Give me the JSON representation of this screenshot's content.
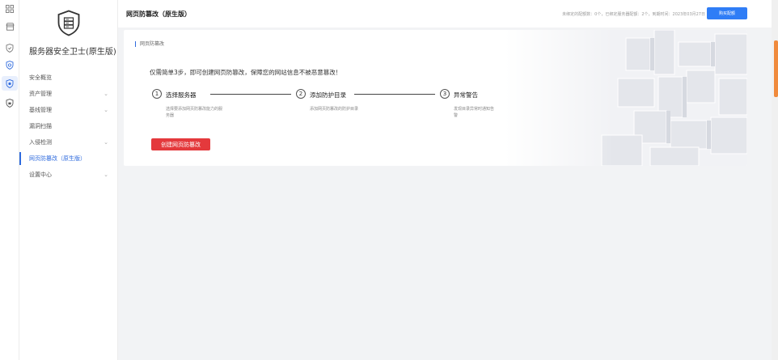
{
  "rail": {
    "icons": [
      "apps-icon",
      "store-icon",
      "shield-check-icon",
      "shield-icon",
      "shield-active-icon",
      "shield-lock-icon"
    ]
  },
  "sidebar": {
    "product_name": "服务器安全卫士(原生版)",
    "items": [
      {
        "label": "安全概览",
        "has_arrow": false
      },
      {
        "label": "资产管理",
        "has_arrow": true
      },
      {
        "label": "基线管理",
        "has_arrow": true
      },
      {
        "label": "漏洞扫描",
        "has_arrow": false
      },
      {
        "label": "入侵检测",
        "has_arrow": true
      },
      {
        "label": "网页防篡改（原生版）",
        "has_arrow": false
      },
      {
        "label": "设置中心",
        "has_arrow": true
      }
    ]
  },
  "header": {
    "title": "网页防篡改（原生版）",
    "info": "未绑定的配额数：0个，已绑定服务器配额：2个，到期时间：2023年03月27日",
    "buy_label": "购买配额"
  },
  "card": {
    "crumb": "网页防篡改",
    "intro": "仅需简单3步，即可创建网页防篡改，保障您的网站信息不被恶意篡改！",
    "steps": [
      {
        "num": "1",
        "title": "选择服务器",
        "desc": "选择要添加网页防篡改能力的服务器"
      },
      {
        "num": "2",
        "title": "添加防护目录",
        "desc": "添加网页防篡改的防护目录"
      },
      {
        "num": "3",
        "title": "异常警告",
        "desc": "发现目录异常时通知告警"
      }
    ],
    "create_label": "创建网页防篡改"
  },
  "colors": {
    "primary": "#2f6bde",
    "buy_button": "#2f7df6",
    "create_button": "#e4393c"
  }
}
